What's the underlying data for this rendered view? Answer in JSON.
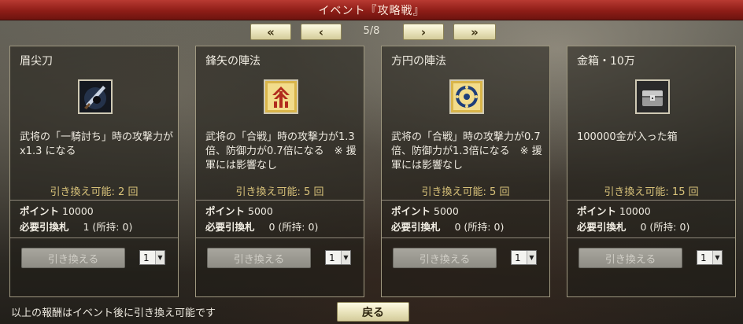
{
  "window": {
    "title": "イベント『攻略戦』"
  },
  "pager": {
    "first_label": "«",
    "prev_label": "‹",
    "page_text": "5/8",
    "next_label": "›",
    "last_label": "»"
  },
  "cards": [
    {
      "title": "眉尖刀",
      "icon": "blade-weapon-icon",
      "description": "武将の「一騎討ち」時の攻撃力が x1.3 になる",
      "available": "引き換え可能: 2 回",
      "points_label": "ポイント",
      "points_value": "10000",
      "tickets_label": "必要引換札",
      "tickets_value": "1 (所持: 0)",
      "exchange_label": "引き換える",
      "quantity": "1"
    },
    {
      "title": "鋒矢の陣法",
      "icon": "arrow-formation-icon",
      "description": "武将の「合戦」時の攻撃力が1.3倍、防御力が0.7倍になる　※ 援軍には影響なし",
      "available": "引き換え可能: 5 回",
      "points_label": "ポイント",
      "points_value": "5000",
      "tickets_label": "必要引換札",
      "tickets_value": "0 (所持: 0)",
      "exchange_label": "引き換える",
      "quantity": "1"
    },
    {
      "title": "方円の陣法",
      "icon": "circle-formation-icon",
      "description": "武将の「合戦」時の攻撃力が0.7倍、防御力が1.3倍になる　※ 援軍には影響なし",
      "available": "引き換え可能: 5 回",
      "points_label": "ポイント",
      "points_value": "5000",
      "tickets_label": "必要引換札",
      "tickets_value": "0 (所持: 0)",
      "exchange_label": "引き換える",
      "quantity": "1"
    },
    {
      "title": "金箱・10万",
      "icon": "treasure-chest-icon",
      "description": "100000金が入った箱",
      "available": "引き換え可能: 15 回",
      "points_label": "ポイント",
      "points_value": "10000",
      "tickets_label": "必要引換札",
      "tickets_value": "0 (所持: 0)",
      "exchange_label": "引き換える",
      "quantity": "1"
    }
  ],
  "footer": {
    "note": "以上の報酬はイベント後に引き換え可能です",
    "back_label": "戻る"
  },
  "colors": {
    "titlebar": "#8e1d17",
    "button_face": "#eae4bd",
    "available_text": "#d8c27a"
  }
}
